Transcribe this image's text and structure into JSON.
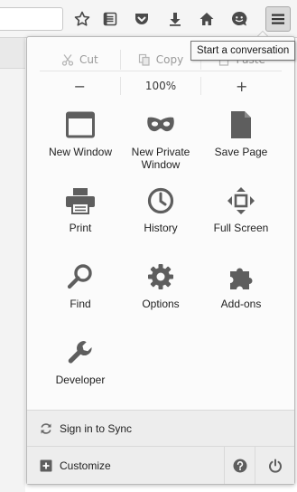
{
  "toolbar": {
    "buttons": [
      {
        "name": "bookmark-star-icon"
      },
      {
        "name": "reading-list-icon"
      },
      {
        "name": "pocket-icon"
      },
      {
        "name": "download-icon"
      },
      {
        "name": "home-icon"
      },
      {
        "name": "hello-chat-icon"
      },
      {
        "name": "hamburger-menu-icon"
      }
    ]
  },
  "tooltip": "Start a conversation",
  "menu": {
    "edit": {
      "cut": "Cut",
      "copy": "Copy",
      "paste": "Paste"
    },
    "zoom": {
      "minus": "−",
      "level": "100%",
      "plus": "+"
    },
    "items": [
      {
        "id": "new-window",
        "label": "New Window",
        "icon": "window-icon"
      },
      {
        "id": "new-private-window",
        "label": "New Private Window",
        "icon": "mask-icon"
      },
      {
        "id": "save-page",
        "label": "Save Page",
        "icon": "page-icon"
      },
      {
        "id": "print",
        "label": "Print",
        "icon": "printer-icon"
      },
      {
        "id": "history",
        "label": "History",
        "icon": "clock-icon"
      },
      {
        "id": "full-screen",
        "label": "Full Screen",
        "icon": "fullscreen-icon"
      },
      {
        "id": "find",
        "label": "Find",
        "icon": "magnifier-icon"
      },
      {
        "id": "options",
        "label": "Options",
        "icon": "gear-icon"
      },
      {
        "id": "add-ons",
        "label": "Add-ons",
        "icon": "puzzle-icon"
      },
      {
        "id": "developer",
        "label": "Developer",
        "icon": "wrench-icon"
      }
    ],
    "sync_label": "Sign in to Sync",
    "customize_label": "Customize"
  },
  "colors": {
    "icon": "#5e5e5e",
    "panel_bg": "#fbfbfb",
    "footer_bg": "#ededed"
  }
}
